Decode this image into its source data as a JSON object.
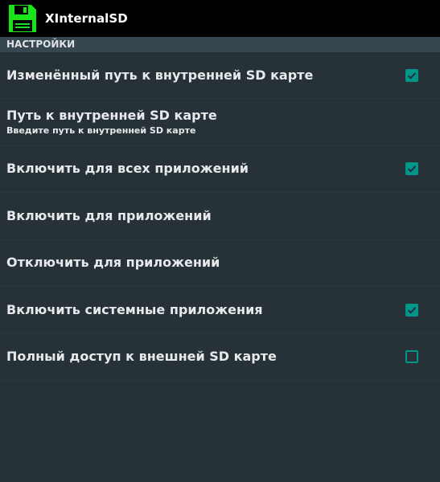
{
  "app": {
    "title": "XInternalSD",
    "icon": "floppy-disk-icon",
    "icon_color": "#19e619"
  },
  "colors": {
    "accent": "#009688",
    "background": "#263238",
    "header_bg": "#37474f",
    "action_bar": "#000000"
  },
  "category": {
    "label": "НАСТРОЙКИ"
  },
  "preferences": [
    {
      "title": "Изменённый путь к внутренней SD карте",
      "has_checkbox": true,
      "checked": true
    },
    {
      "title": "Путь к внутренней SD карте",
      "summary": "Введите путь к внутренней SD карте",
      "has_checkbox": false
    },
    {
      "title": "Включить для всех приложений",
      "has_checkbox": true,
      "checked": true
    },
    {
      "title": "Включить для приложений",
      "has_checkbox": false
    },
    {
      "title": "Отключить для приложений",
      "has_checkbox": false
    },
    {
      "title": "Включить системные приложения",
      "has_checkbox": true,
      "checked": true
    },
    {
      "title": "Полный доступ к внешней SD карте",
      "has_checkbox": true,
      "checked": false
    }
  ]
}
